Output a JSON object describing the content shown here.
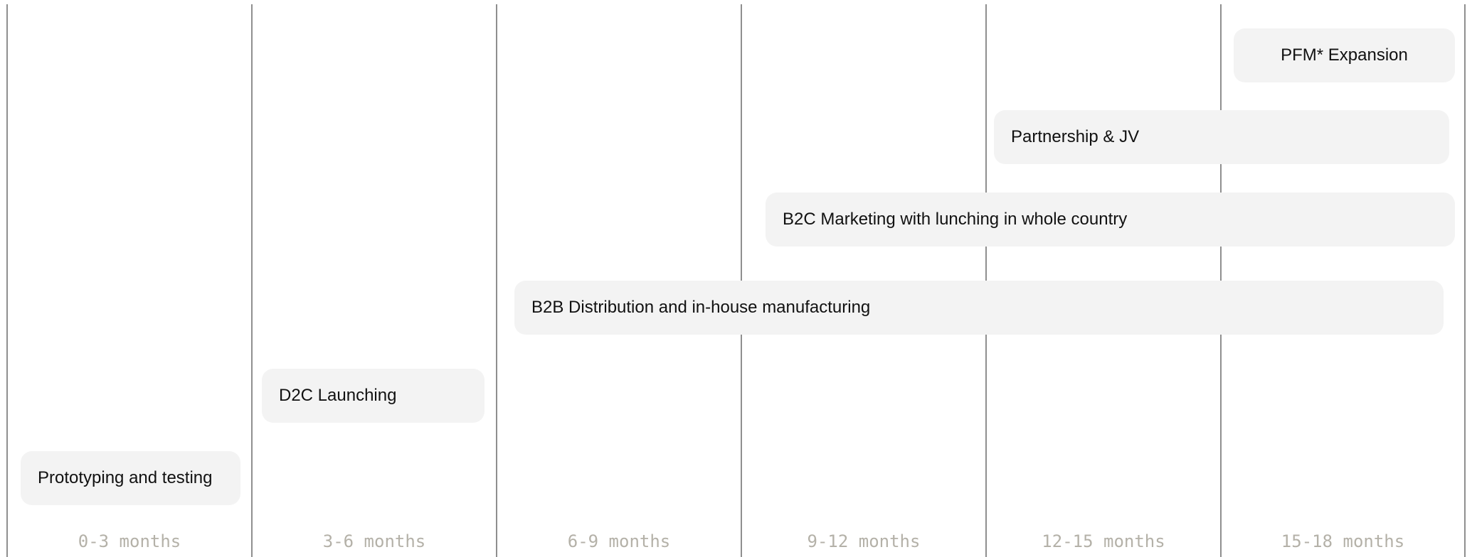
{
  "timeline": {
    "periods": [
      {
        "label": "0-3 months"
      },
      {
        "label": "3-6 months"
      },
      {
        "label": "6-9 months"
      },
      {
        "label": "9-12 months"
      },
      {
        "label": "12-15 months"
      },
      {
        "label": "15-18 months"
      }
    ],
    "phases": [
      {
        "label": "PFM* Expansion"
      },
      {
        "label": "Partnership & JV"
      },
      {
        "label": "B2C Marketing with lunching in whole country"
      },
      {
        "label": "B2B Distribution and in-house manufacturing"
      },
      {
        "label": "D2C Launching"
      },
      {
        "label": "Prototyping and testing"
      }
    ]
  }
}
